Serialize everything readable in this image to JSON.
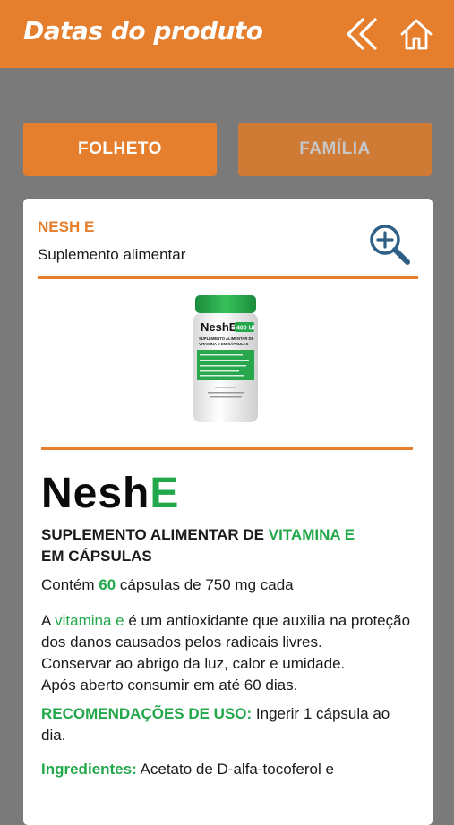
{
  "header": {
    "title": "Datas do produto"
  },
  "tabs": [
    {
      "label": "FOLHETO"
    },
    {
      "label": "FAMÍLIA"
    }
  ],
  "product": {
    "name": "NESH E",
    "subtitle": "Suplemento alimentar",
    "bottle": {
      "label_title": "NeshE",
      "label_badge": "400 UI",
      "label_line1": "SUPLEMENTO ALIMENTAR DE",
      "label_line2": "VITAMINA E EM CÁPSULAS"
    },
    "brand_prefix": "Nesh",
    "brand_suffix": "E",
    "heading_part1": "SUPLEMENTO ALIMENTAR DE ",
    "heading_green": "VITAMINA E",
    "heading_part2": "EM CÁPSULAS",
    "contents_prefix": "Contém ",
    "contents_count": "60",
    "contents_suffix": " cápsulas de 750 mg cada",
    "desc_prefix": "A ",
    "desc_green": "vitamina e",
    "desc_suffix": " é um antioxidante que auxilia na proteção dos danos causados pelos radicais livres.",
    "storage": "Conservar ao abrigo da luz, calor e umidade.",
    "after_open": "Após aberto consumir em até 60 dias.",
    "recommend_label": "RECOMENDAÇÕES DE USO:",
    "recommend_text": " Ingerir 1 cápsula ao dia.",
    "ingredients_label": "Ingredientes:",
    "ingredients_text": " Acetato de D-alfa-tocoferol e"
  },
  "colors": {
    "accent": "#e57f2e",
    "green": "#22a84a",
    "background": "#7a7a7a"
  }
}
